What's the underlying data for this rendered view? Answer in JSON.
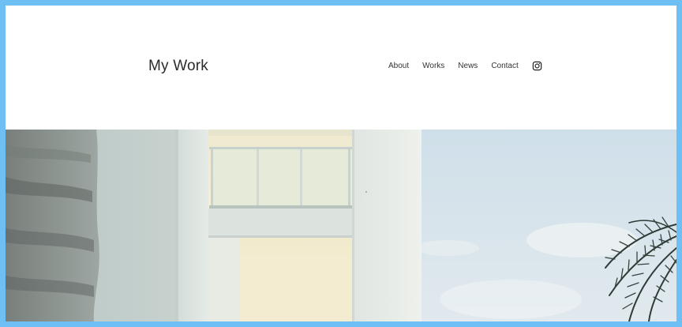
{
  "site": {
    "title": "My Work"
  },
  "nav": {
    "items": [
      {
        "label": "About"
      },
      {
        "label": "Works"
      },
      {
        "label": "News"
      },
      {
        "label": "Contact"
      }
    ],
    "social_icon": "instagram-icon"
  },
  "hero": {
    "image": "white-building-balcony-with-palm-tree"
  },
  "colors": {
    "frame": "#6ec0f4",
    "text": "#2b2b2b",
    "background": "#ffffff"
  }
}
